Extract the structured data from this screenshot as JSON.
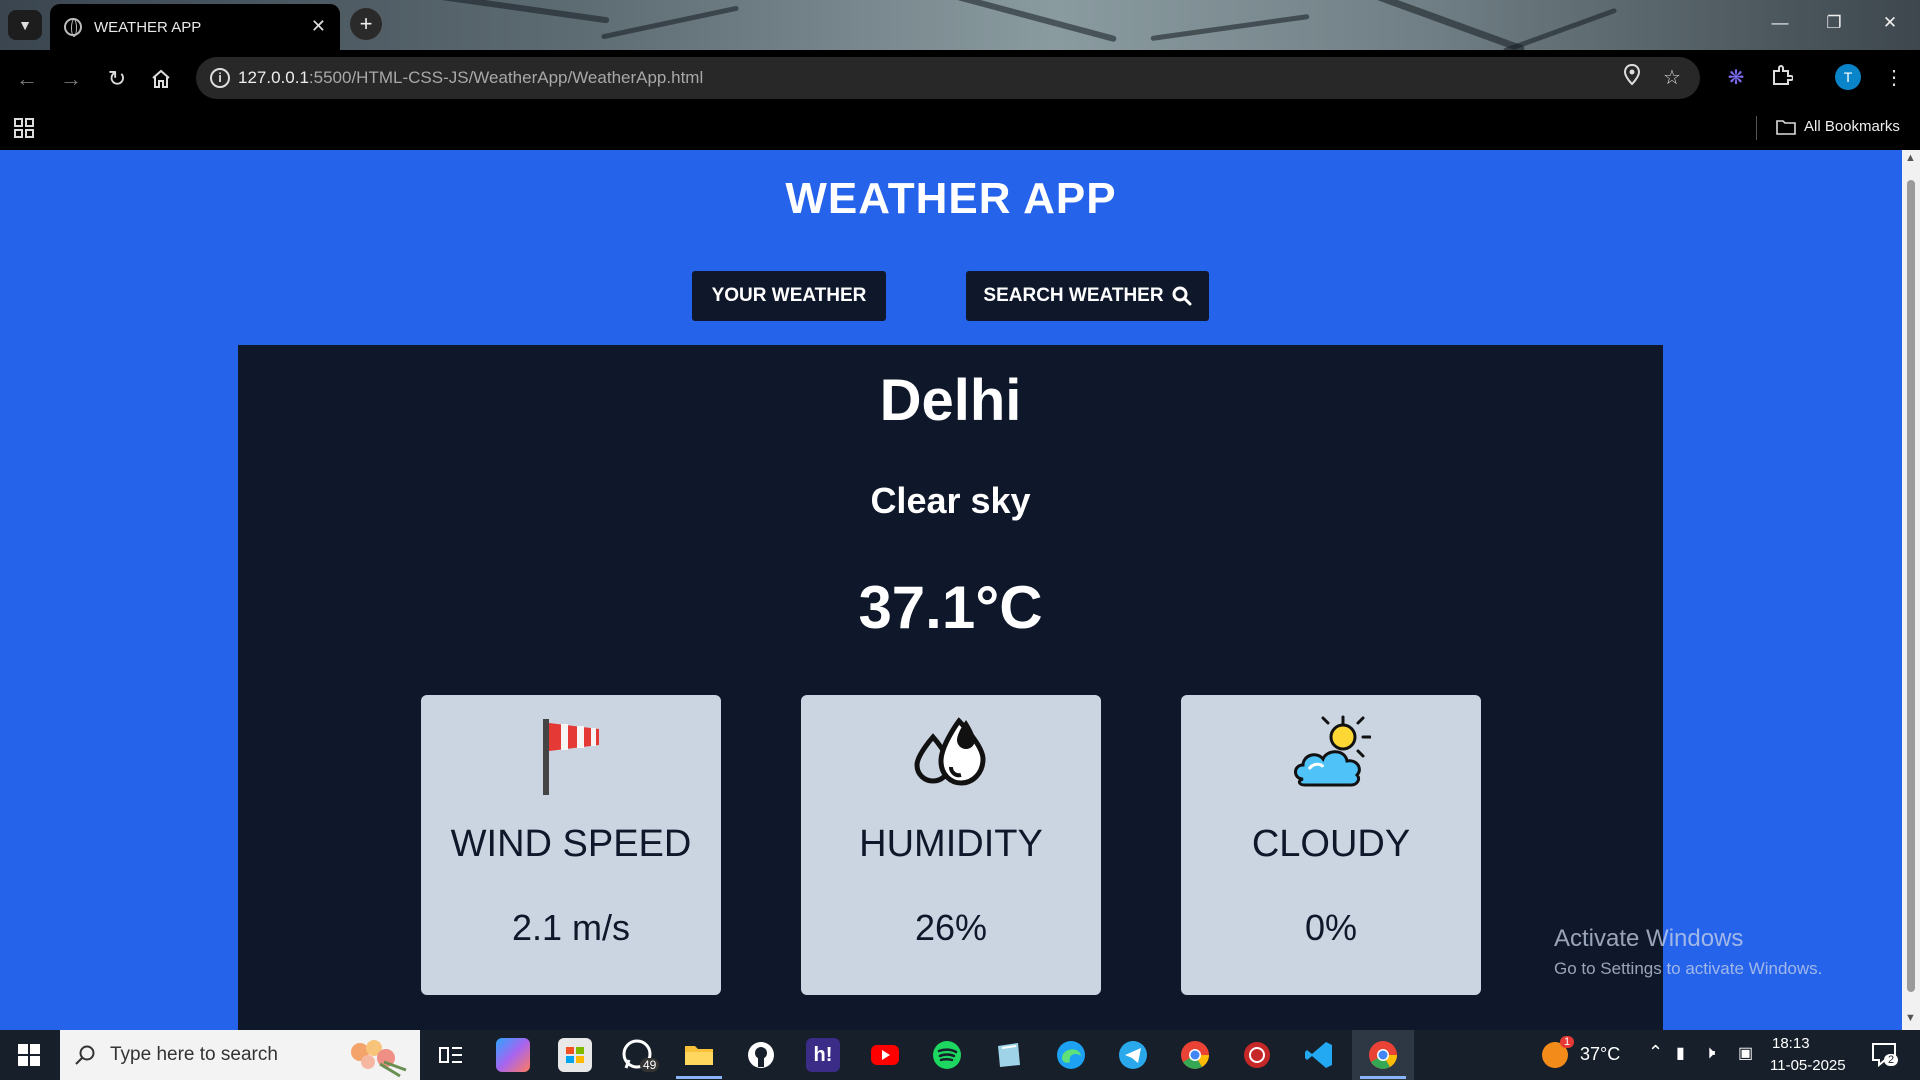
{
  "browser": {
    "tab_title": "WEATHER APP",
    "url_host": "127.0.0.1",
    "url_rest": ":5500/HTML-CSS-JS/WeatherApp/WeatherApp.html",
    "bookmarks_label": "All Bookmarks",
    "profile_initial": "T"
  },
  "app": {
    "title": "WEATHER APP",
    "tabs": [
      {
        "label": "YOUR WEATHER"
      },
      {
        "label": "SEARCH WEATHER"
      }
    ],
    "weather": {
      "city": "Delhi",
      "description": "Clear sky",
      "temperature": "37.1°C"
    },
    "stats": [
      {
        "label": "WIND SPEED",
        "value": "2.1 m/s",
        "icon": "windsock-icon"
      },
      {
        "label": "HUMIDITY",
        "value": "26%",
        "icon": "water-drops-icon"
      },
      {
        "label": "CLOUDY",
        "value": "0%",
        "icon": "sun-cloud-icon"
      }
    ]
  },
  "watermark": {
    "line1": "Activate Windows",
    "line2": "Go to Settings to activate Windows."
  },
  "taskbar": {
    "search_placeholder": "Type here to search",
    "whatsapp_badge": "49",
    "weather_temp": "37°C",
    "weather_badge": "1",
    "time": "18:13",
    "date": "11-05-2025",
    "notification_count": "2"
  },
  "colors": {
    "page_bg": "#2563eb",
    "card_bg": "#0f172a",
    "stat_bg": "#cbd5e1"
  }
}
